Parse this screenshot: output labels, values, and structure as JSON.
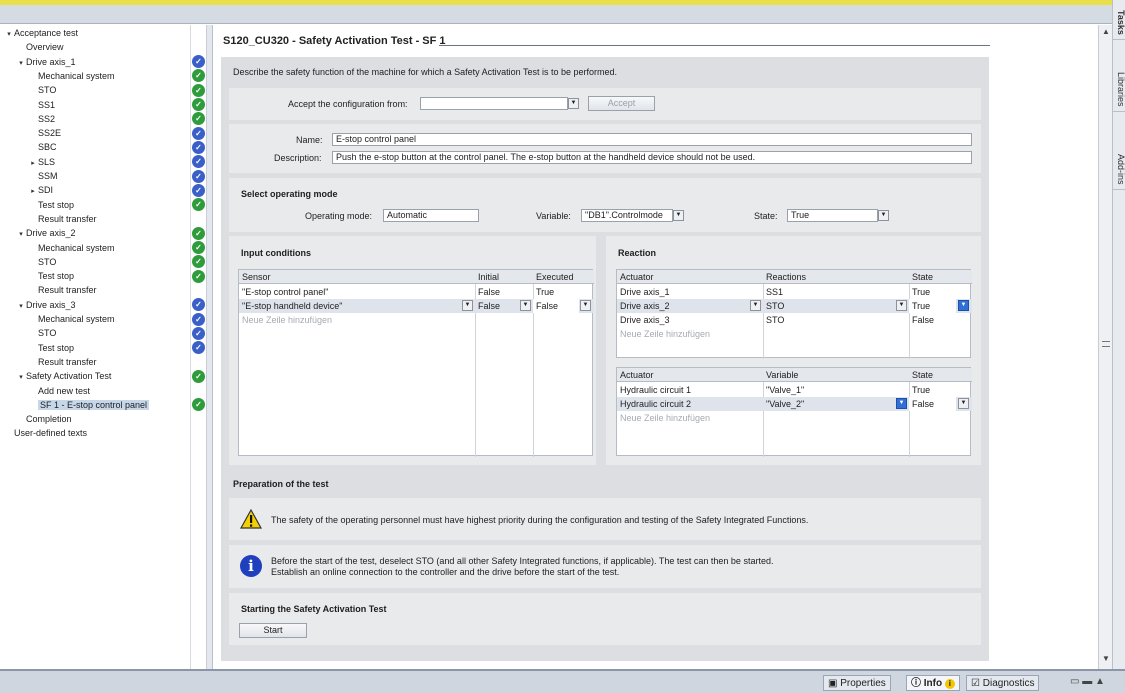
{
  "tree": {
    "items": [
      {
        "label": "Acceptance test",
        "level": 0,
        "toggle": "▾",
        "status": ""
      },
      {
        "label": "Overview",
        "level": 1,
        "toggle": "",
        "status": ""
      },
      {
        "label": "Drive axis_1",
        "level": 1,
        "toggle": "▾",
        "status": "blue"
      },
      {
        "label": "Mechanical system",
        "level": 2,
        "toggle": "",
        "status": "green"
      },
      {
        "label": "STO",
        "level": 2,
        "toggle": "",
        "status": "green"
      },
      {
        "label": "SS1",
        "level": 2,
        "toggle": "",
        "status": "green"
      },
      {
        "label": "SS2",
        "level": 2,
        "toggle": "",
        "status": "green"
      },
      {
        "label": "SS2E",
        "level": 2,
        "toggle": "",
        "status": "blue"
      },
      {
        "label": "SBC",
        "level": 2,
        "toggle": "",
        "status": "blue"
      },
      {
        "label": "SLS",
        "level": 2,
        "toggle": "▸",
        "status": "blue"
      },
      {
        "label": "SSM",
        "level": 2,
        "toggle": "",
        "status": "blue"
      },
      {
        "label": "SDI",
        "level": 2,
        "toggle": "▸",
        "status": "blue"
      },
      {
        "label": "Test stop",
        "level": 2,
        "toggle": "",
        "status": "green"
      },
      {
        "label": "Result transfer",
        "level": 2,
        "toggle": "",
        "status": ""
      },
      {
        "label": "Drive axis_2",
        "level": 1,
        "toggle": "▾",
        "status": "green"
      },
      {
        "label": "Mechanical system",
        "level": 2,
        "toggle": "",
        "status": "green"
      },
      {
        "label": "STO",
        "level": 2,
        "toggle": "",
        "status": "green"
      },
      {
        "label": "Test stop",
        "level": 2,
        "toggle": "",
        "status": "green"
      },
      {
        "label": "Result transfer",
        "level": 2,
        "toggle": "",
        "status": ""
      },
      {
        "label": "Drive axis_3",
        "level": 1,
        "toggle": "▾",
        "status": "blue"
      },
      {
        "label": "Mechanical system",
        "level": 2,
        "toggle": "",
        "status": "blue"
      },
      {
        "label": "STO",
        "level": 2,
        "toggle": "",
        "status": "blue"
      },
      {
        "label": "Test stop",
        "level": 2,
        "toggle": "",
        "status": "blue"
      },
      {
        "label": "Result transfer",
        "level": 2,
        "toggle": "",
        "status": ""
      },
      {
        "label": "Safety Activation Test",
        "level": 1,
        "toggle": "▾",
        "status": "green"
      },
      {
        "label": "Add new test",
        "level": 2,
        "toggle": "",
        "status": ""
      },
      {
        "label": "SF 1 - E-stop control panel",
        "level": 2,
        "toggle": "",
        "status": "green",
        "selected": true
      },
      {
        "label": "Completion",
        "level": 1,
        "toggle": "",
        "status": ""
      },
      {
        "label": "User-defined texts",
        "level": 0,
        "toggle": "",
        "status": ""
      }
    ]
  },
  "editor": {
    "title": "S120_CU320 - Safety Activation Test - SF 1",
    "intro": "Describe the safety function of the machine for which a Safety Activation Test is to be performed.",
    "accept_label": "Accept the configuration from:",
    "accept_value": "",
    "accept_button": "Accept",
    "name_label": "Name:",
    "name_value": "E-stop control panel",
    "desc_label": "Description:",
    "desc_value": "Push the e-stop button at the control panel. The e-stop button at the handheld device should not be used.",
    "op_heading": "Select operating mode",
    "op_mode_label": "Operating mode:",
    "op_mode_value": "Automatic",
    "variable_label": "Variable:",
    "variable_value": "\"DB1\".Controlmode",
    "state_label": "State:",
    "state_value": "True",
    "input_heading": "Input conditions",
    "reaction_heading": "Reaction",
    "input_table": {
      "headers": [
        "Sensor",
        "Initial",
        "Executed"
      ],
      "rows": [
        [
          "\"E-stop control panel\"",
          "False",
          "True"
        ],
        [
          "\"E-stop handheld device\"",
          "False",
          "False"
        ]
      ],
      "add_row": "Neue Zeile hinzufügen"
    },
    "reaction_table": {
      "headers": [
        "Actuator",
        "Reactions",
        "State"
      ],
      "rows": [
        [
          "Drive axis_1",
          "SS1",
          "True"
        ],
        [
          "Drive axis_2",
          "STO",
          "True"
        ],
        [
          "Drive axis_3",
          "STO",
          "False"
        ]
      ],
      "add_row": "Neue Zeile hinzufügen"
    },
    "actuator_table": {
      "headers": [
        "Actuator",
        "Variable",
        "State"
      ],
      "rows": [
        [
          "Hydraulic circuit 1",
          "\"Valve_1\"",
          "True"
        ],
        [
          "Hydraulic circuit 2",
          "\"Valve_2\"",
          "False"
        ]
      ],
      "add_row": "Neue Zeile hinzufügen"
    },
    "prep_heading": "Preparation of the test",
    "warning_text": "The safety of the operating personnel must have highest priority during the configuration and testing of the Safety Integrated Functions.",
    "info_line1": "Before the start of the test, deselect STO (and all other Safety Integrated functions, if applicable). The test can then be started.",
    "info_line2": "Establish an online connection to the controller and the drive before the start of the test.",
    "start_heading": "Starting the Safety Activation Test",
    "start_button": "Start"
  },
  "right_tabs": [
    "Tasks",
    "Libraries",
    "Add-ins"
  ],
  "statusbar": {
    "properties": "Properties",
    "info": "Info",
    "diagnostics": "Diagnostics"
  },
  "colors": {
    "status_blue": "#3a5fc8",
    "status_green": "#2e9c3a",
    "top_stripe": "#e8e04a"
  }
}
